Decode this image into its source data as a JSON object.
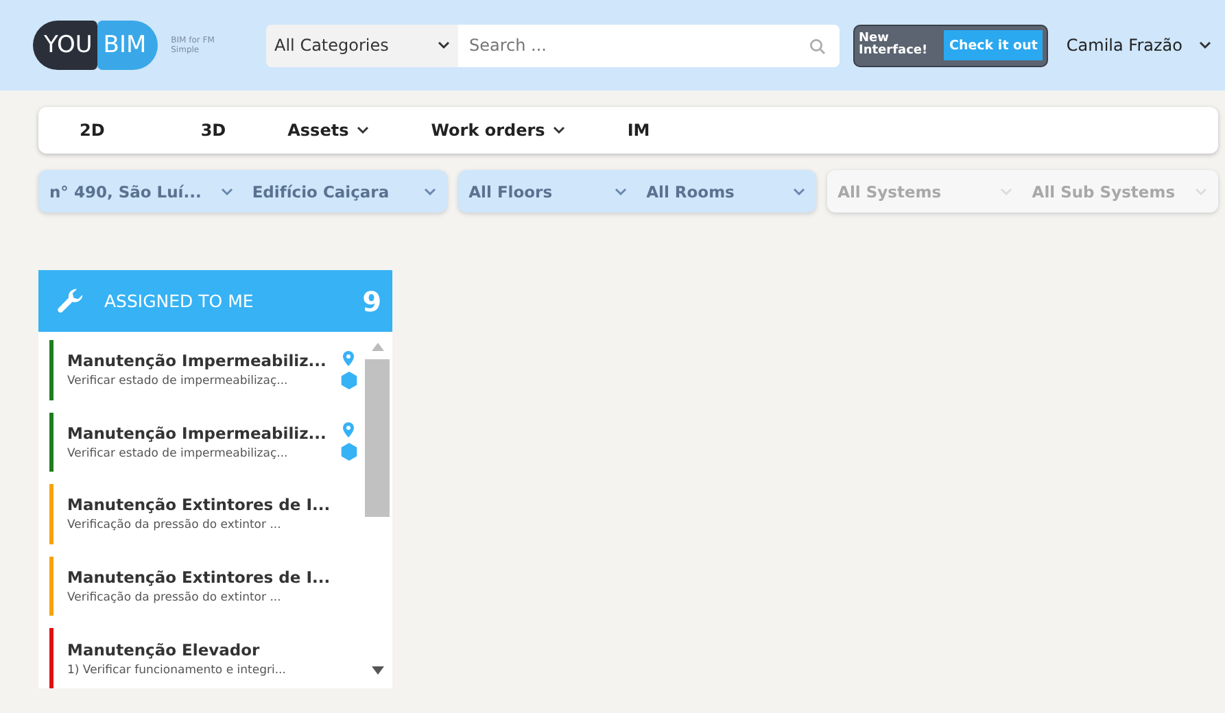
{
  "header": {
    "logo": {
      "left": "YOU",
      "right": "BIM",
      "tagline": "BIM for FM Simple"
    },
    "category": "All Categories",
    "search": {
      "placeholder": "Search ..."
    },
    "promo": {
      "text": "New Interface!",
      "button": "Check it out"
    },
    "user": "Camila Frazão"
  },
  "nav": [
    {
      "label": "2D",
      "dropdown": false
    },
    {
      "label": "3D",
      "dropdown": false
    },
    {
      "label": "Assets",
      "dropdown": true
    },
    {
      "label": "Work orders",
      "dropdown": true
    },
    {
      "label": "IM",
      "dropdown": false
    }
  ],
  "filters": [
    {
      "disabled": false,
      "items": [
        "n° 490, São Luí...",
        "Edifício Caiçara"
      ]
    },
    {
      "disabled": false,
      "items": [
        "All Floors",
        "All Rooms"
      ]
    },
    {
      "disabled": true,
      "items": [
        "All Systems",
        "All Sub Systems"
      ]
    }
  ],
  "panel": {
    "title": "ASSIGNED TO ME",
    "count": "9",
    "items": [
      {
        "title": "Manutenção Impermeabiliz...",
        "subtitle": "Verificar estado de impermeabilizaç...",
        "color": "#1e7d1e",
        "located": true,
        "in_model": true
      },
      {
        "title": "Manutenção Impermeabiliz...",
        "subtitle": "Verificar estado de impermeabilizaç...",
        "color": "#1e7d1e",
        "located": true,
        "in_model": true
      },
      {
        "title": "Manutenção Extintores de I...",
        "subtitle": "Verificação da pressão do extintor ...",
        "color": "#f5a300",
        "located": false,
        "in_model": false
      },
      {
        "title": "Manutenção Extintores de I...",
        "subtitle": "Verificação da pressão do extintor ...",
        "color": "#f5a300",
        "located": false,
        "in_model": false
      },
      {
        "title": "Manutenção Elevador",
        "subtitle": "1) Verificar funcionamento e integri...",
        "color": "#e01010",
        "located": false,
        "in_model": false
      }
    ]
  }
}
